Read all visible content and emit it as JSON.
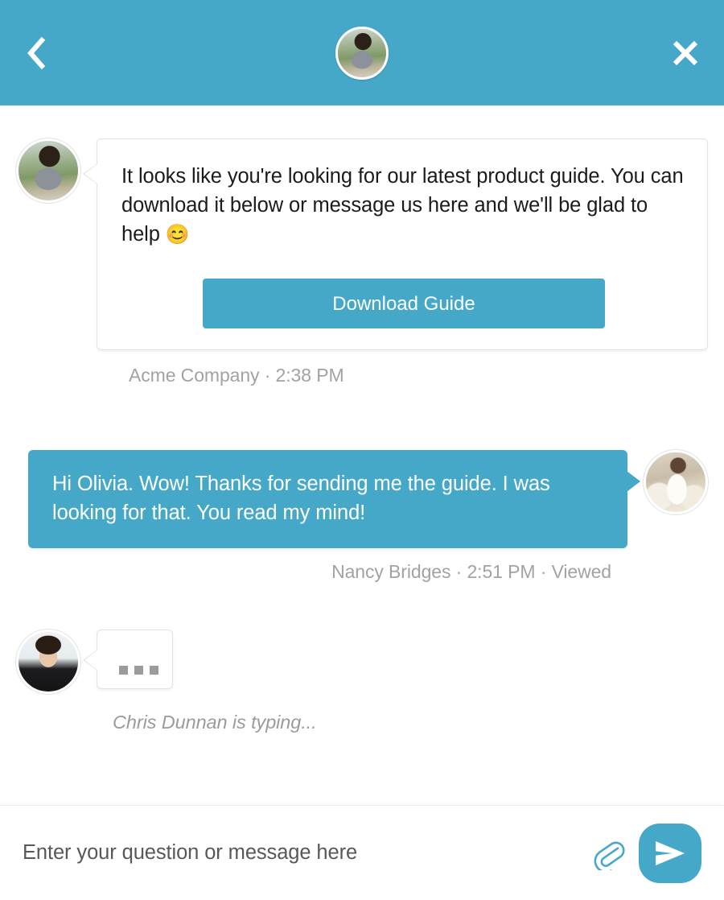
{
  "header": {
    "back_icon": "chevron-left-icon",
    "close_icon": "close-icon",
    "avatar_alt": "Olivia avatar",
    "background_color": "#46a8c8"
  },
  "conversation": {
    "messages": [
      {
        "side": "left",
        "author": "Acme Company",
        "time": "2:38 PM",
        "meta": "Acme Company · 2:38 PM",
        "text": "It looks like you're looking for our latest product guide. You can download it below or message us here and we'll be glad to help ",
        "emoji": "😊",
        "cta_label": "Download Guide",
        "avatar_alt": "Olivia avatar"
      },
      {
        "side": "right",
        "author": "Nancy Bridges",
        "time": "2:51 PM",
        "status": "Viewed",
        "meta": "Nancy Bridges · 2:51 PM · Viewed",
        "text": "Hi Olivia. Wow! Thanks for sending me the guide. I was looking for that. You read my mind!",
        "avatar_alt": "Nancy Bridges avatar"
      }
    ],
    "typing": {
      "label": "Chris Dunnan is typing...",
      "avatar_alt": "Chris Dunnan avatar",
      "dots": 3
    }
  },
  "composer": {
    "placeholder": "Enter your question or message here",
    "value": "",
    "attach_icon": "paperclip-icon",
    "send_icon": "send-icon",
    "accent_color": "#46a8c8"
  }
}
